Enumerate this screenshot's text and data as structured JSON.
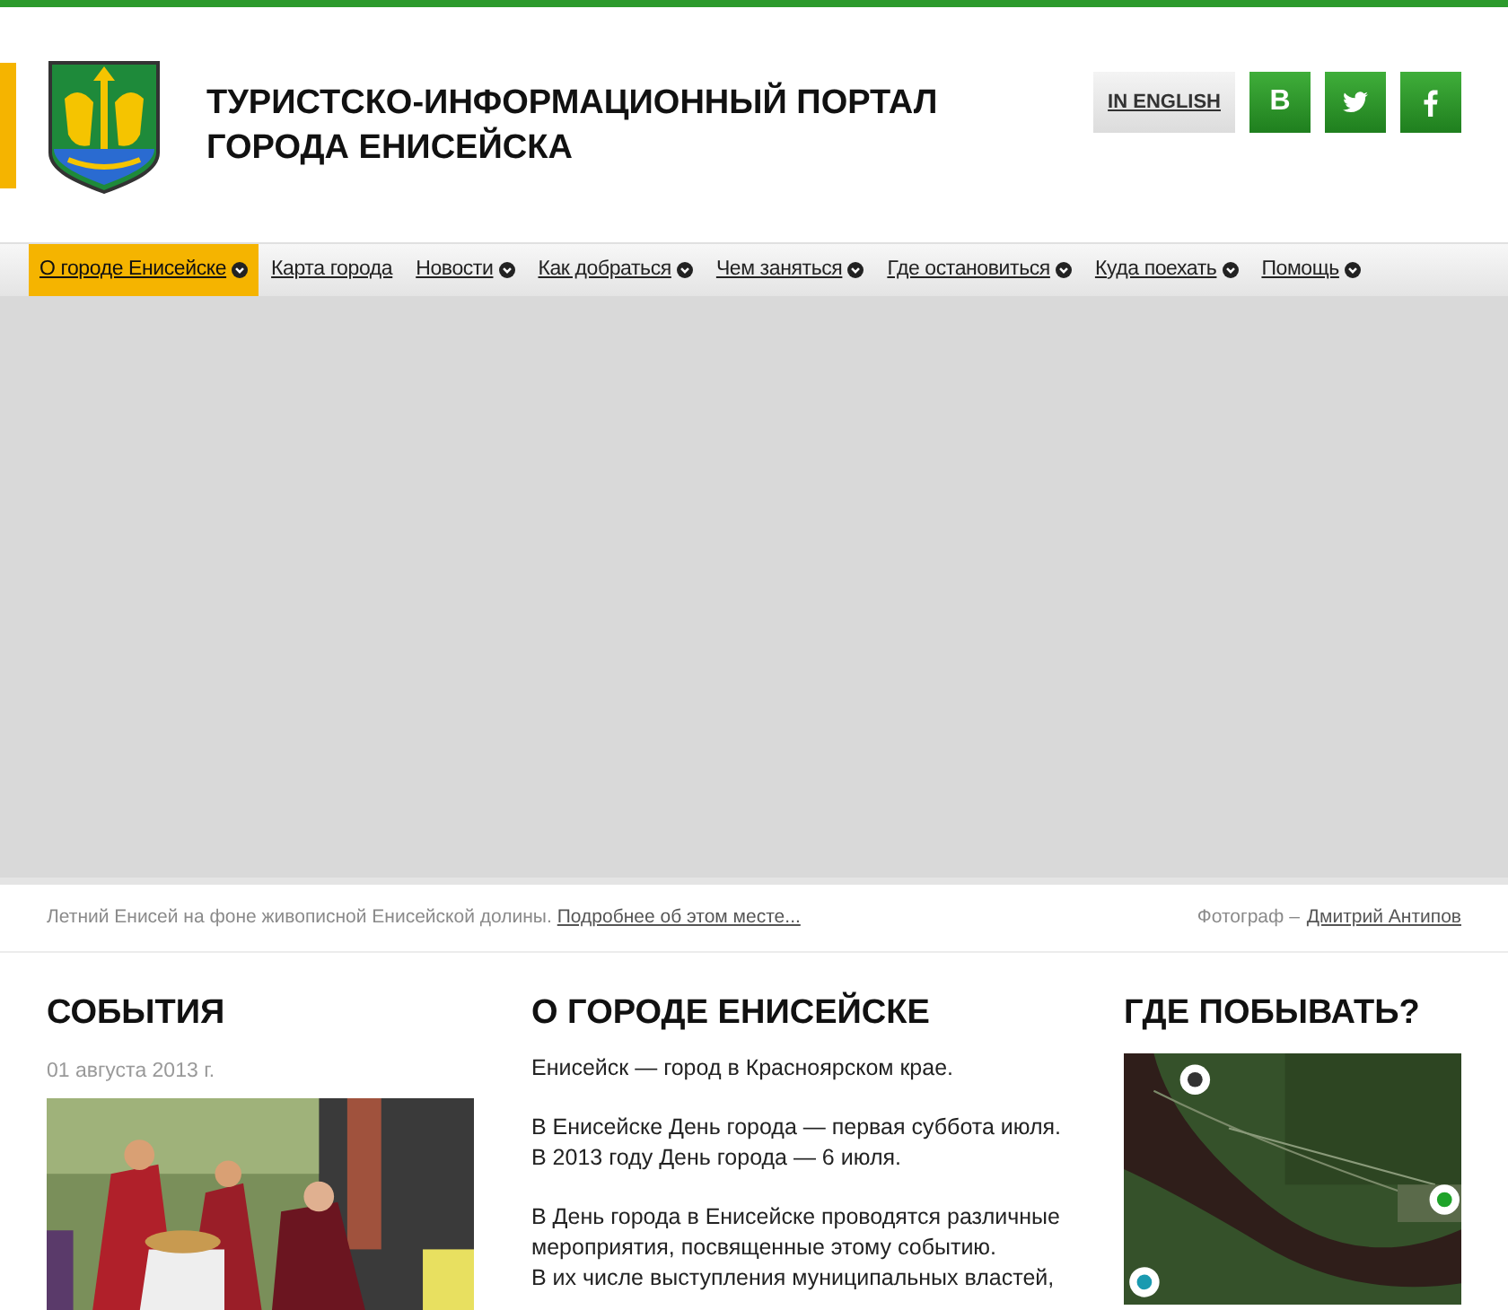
{
  "header": {
    "title_lines": [
      "ТУРИСТСКО-ИНФОРМАЦИОННЫЙ ПОРТАЛ",
      "ГОРОДА ЕНИСЕЙСКА"
    ],
    "language_link": "IN ENGLISH",
    "social": [
      {
        "kind": "vk",
        "label": "B"
      },
      {
        "kind": "twitter"
      },
      {
        "kind": "facebook"
      }
    ]
  },
  "nav": [
    {
      "label": "О городе Енисейске",
      "selected": true,
      "dropdown": true
    },
    {
      "label": "Карта города",
      "selected": false,
      "dropdown": false
    },
    {
      "label": "Новости",
      "selected": false,
      "dropdown": true
    },
    {
      "label": "Как добраться",
      "selected": false,
      "dropdown": true
    },
    {
      "label": "Чем заняться",
      "selected": false,
      "dropdown": true
    },
    {
      "label": "Где остановиться",
      "selected": false,
      "dropdown": true
    },
    {
      "label": "Куда поехать",
      "selected": false,
      "dropdown": true
    },
    {
      "label": "Помощь",
      "selected": false,
      "dropdown": true
    }
  ],
  "caption": {
    "text": "Летний Енисей на фоне живописной Енисейской долины.",
    "link": "Подробнее об этом месте...",
    "credit_label": "Фотограф –",
    "credit_name": "Дмитрий Антипов"
  },
  "events": {
    "heading": "СОБЫТИЯ",
    "date": "01 августа 2013 г."
  },
  "about": {
    "heading": "О ГОРОДЕ ЕНИСЕЙСКЕ",
    "paragraphs": [
      [
        "Енисейск — город в Красноярском крае."
      ],
      [
        "В Енисейске День города — первая суббота июля.",
        "В 2013 году День города — 6 июля."
      ],
      [
        "В День города в Енисейске проводятся различные",
        "мероприятия, посвященные этому событию.",
        "В их числе выступления муниципальных властей,"
      ]
    ]
  },
  "places": {
    "heading": "ГДЕ ПОБЫВАТЬ?"
  }
}
